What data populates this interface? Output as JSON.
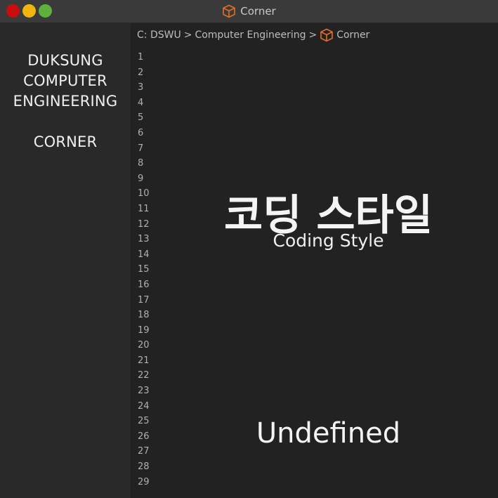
{
  "window": {
    "title": "Corner",
    "icon": "box-icon",
    "accent": "#e0702a"
  },
  "sidebar": {
    "lines": [
      "DUKSUNG",
      "COMPUTER",
      "ENGINEERING"
    ],
    "section": "CORNER"
  },
  "breadcrumb": {
    "root": "C: DSWU",
    "sep1": ">",
    "folder": "Computer Engineering",
    "sep2": ">",
    "file": "Corner"
  },
  "gutter": {
    "lines": [
      "1",
      "2",
      "3",
      "4",
      "5",
      "6",
      "7",
      "8",
      "9",
      "10",
      "11",
      "12",
      "13",
      "14",
      "15",
      "16",
      "17",
      "18",
      "19",
      "20",
      "21",
      "22",
      "23",
      "24",
      "25",
      "26",
      "27",
      "28",
      "29"
    ]
  },
  "content": {
    "title": "코딩 스타일",
    "subtitle": "Coding Style",
    "footer": "Undefined"
  }
}
